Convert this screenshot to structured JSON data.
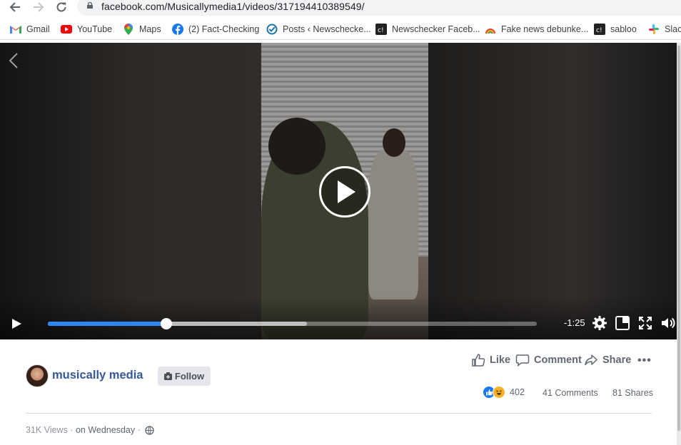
{
  "browser": {
    "url": "facebook.com/Musicallymedia1/videos/317194410389549/",
    "bookmarks": [
      {
        "label": "Gmail",
        "icon": "gmail-icon"
      },
      {
        "label": "YouTube",
        "icon": "youtube-icon"
      },
      {
        "label": "Maps",
        "icon": "maps-icon"
      },
      {
        "label": "(2) Fact-Checking",
        "icon": "facebook-icon"
      },
      {
        "label": "Posts ‹ Newschecke...",
        "icon": "newschecker-icon"
      },
      {
        "label": "Newschecker Faceb...",
        "icon": "newschecker-logo-icon"
      },
      {
        "label": "Fake news debunke...",
        "icon": "rainbow-icon"
      },
      {
        "label": "sabloo",
        "icon": "newschecker-logo-icon"
      },
      {
        "label": "Slac",
        "icon": "slack-icon"
      }
    ]
  },
  "video": {
    "time_remaining": "-1:25",
    "progress": 0.243,
    "buffered": 0.53
  },
  "post": {
    "page_name": "musically media",
    "follow_label": "Follow",
    "actions": {
      "like": "Like",
      "comment": "Comment",
      "share": "Share"
    },
    "reaction_count": "402",
    "comments": "41 Comments",
    "shares": "81 Shares",
    "views": "31K Views",
    "posted": "on Wednesday"
  },
  "colors": {
    "link": "#365899",
    "accent": "#2d88ff",
    "like": "#1877f2"
  }
}
